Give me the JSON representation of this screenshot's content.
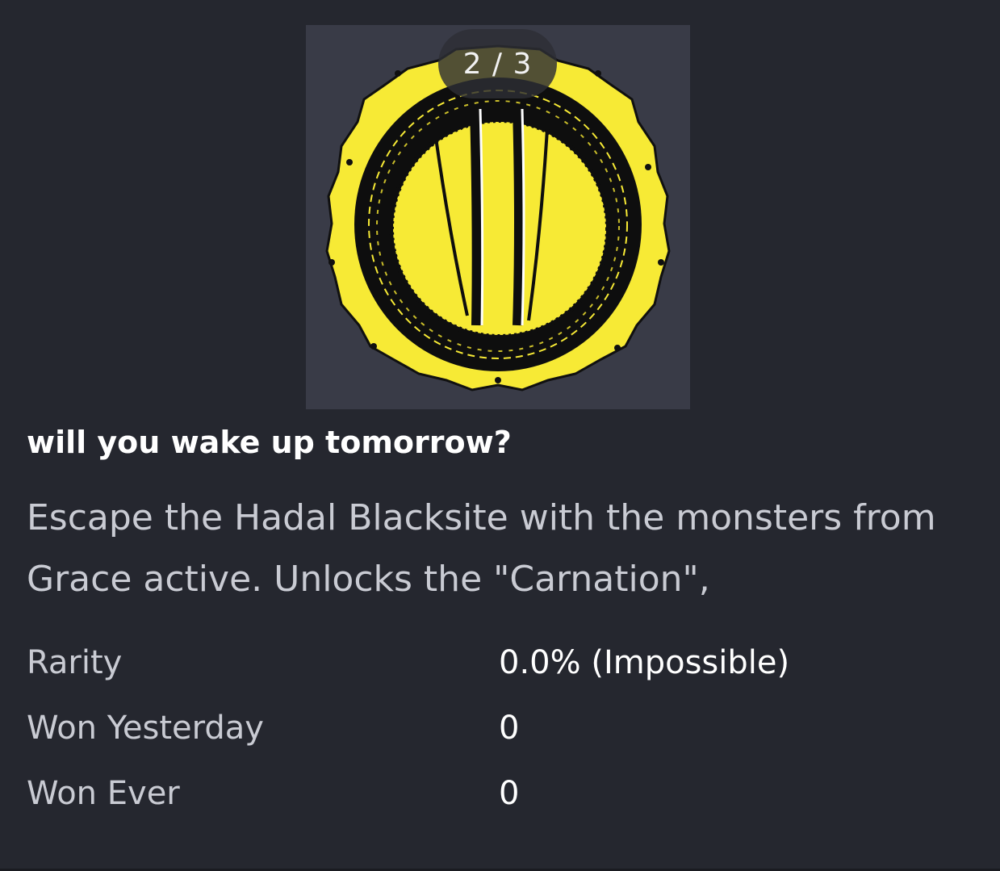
{
  "badge": {
    "icon": "yellow-gear-portal-badge",
    "colors": {
      "background": "#393b47",
      "yellow": "#f7ea35",
      "black": "#0e0e0e"
    }
  },
  "pager": {
    "text": "2 / 3"
  },
  "title": "will you wake up tomorrow?",
  "description": "Escape the Hadal Blacksite with the monsters from Grace active. Unlocks the \"Carnation\",",
  "stats": [
    {
      "label": "Rarity",
      "value": "0.0% (Impossible)"
    },
    {
      "label": "Won Yesterday",
      "value": "0"
    },
    {
      "label": "Won Ever",
      "value": "0"
    }
  ]
}
